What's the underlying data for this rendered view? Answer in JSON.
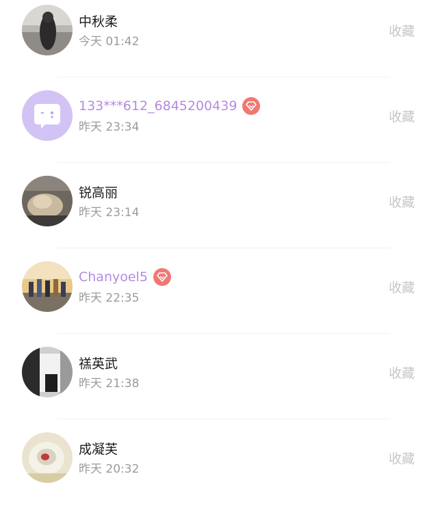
{
  "favorite_label": "收藏",
  "users": [
    {
      "name": "中秋柔",
      "time": "今天 01:42",
      "vip": false,
      "avatar": "photo-avatar"
    },
    {
      "name": "133***612_6845200439",
      "time": "昨天 23:34",
      "vip": true,
      "avatar": "default-chat-avatar"
    },
    {
      "name": "锐高丽",
      "time": "昨天 23:14",
      "vip": false,
      "avatar": "photo-avatar"
    },
    {
      "name": "Chanyoel5",
      "time": "昨天 22:35",
      "vip": true,
      "avatar": "photo-avatar"
    },
    {
      "name": "禚英武",
      "time": "昨天 21:38",
      "vip": false,
      "avatar": "photo-avatar"
    },
    {
      "name": "成凝芙",
      "time": "昨天 20:32",
      "vip": false,
      "avatar": "photo-avatar"
    }
  ],
  "colors": {
    "vip_name": "#b48ae0",
    "vip_badge": "#f07873",
    "default_avatar_bg": "#d3c3f4"
  }
}
